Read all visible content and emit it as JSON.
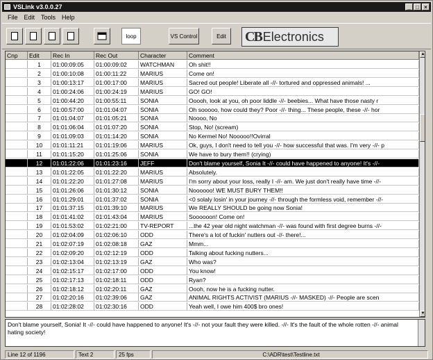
{
  "window": {
    "title": "VSLink v3.0.0.27",
    "controls": [
      "_",
      "□",
      "×"
    ]
  },
  "menu": [
    "File",
    "Edit",
    "Tools",
    "Help"
  ],
  "toolbar": {
    "loop_label": "loop",
    "vs_control_label": "VS Control",
    "edit_label": "Edit",
    "logo_mark": "CB",
    "logo_text": "Electronics"
  },
  "grid": {
    "columns": [
      "Cnp",
      "Edit",
      "Rec In",
      "Rec Out",
      "Character",
      "Comment"
    ],
    "selected_row": 12,
    "rows": [
      {
        "edit": "1",
        "in": "01:00:09:05",
        "out": "01:00:09:02",
        "char": "WATCHMAN",
        "comment": "Oh shit!!"
      },
      {
        "edit": "2",
        "in": "01:00:10:08",
        "out": "01:00:11:22",
        "char": "MARIUS",
        "comment": "Come on!"
      },
      {
        "edit": "3",
        "in": "01:00:13:17",
        "out": "01:00:17:00",
        "char": "MARIUS",
        "comment": "Sacred out people! Liberate all -//- tortured and oppressed animals! ..."
      },
      {
        "edit": "4",
        "in": "01:00:24:06",
        "out": "01:00:24:19",
        "char": "MARIUS",
        "comment": "GO! GO!"
      },
      {
        "edit": "5",
        "in": "01:00:44:20",
        "out": "01:00:55:11",
        "char": "SONIA",
        "comment": "Ooooh, look at you, oh poor liddle -//- beebies... What have those nasty r"
      },
      {
        "edit": "6",
        "in": "01:00:57:00",
        "out": "01:01:04:07",
        "char": "SONIA",
        "comment": "Oh sooooo, how could they? Poor -//- thing... These people, these -//- hor"
      },
      {
        "edit": "7",
        "in": "01:01:04:07",
        "out": "01:01:05:21",
        "char": "SONIA",
        "comment": "Noooo, No"
      },
      {
        "edit": "8",
        "in": "01:01:06:04",
        "out": "01:01:07:20",
        "char": "SONIA",
        "comment": "Stop, No! (scream)"
      },
      {
        "edit": "9",
        "in": "01:01:09:03",
        "out": "01:01:14:20",
        "char": "SONIA",
        "comment": "No Kermel No! Nooooo!!Ovirral"
      },
      {
        "edit": "10",
        "in": "01:01:11:21",
        "out": "01:01:19:06",
        "char": "MARIUS",
        "comment": "Ok, guys, I don't need to tell you -//- how successful that was. I'm very -//- p"
      },
      {
        "edit": "11",
        "in": "01:01:15:20",
        "out": "01:01:25:06",
        "char": "SONIA",
        "comment": "We have to bury them!! (crying)"
      },
      {
        "edit": "12",
        "in": "01:01:22:06",
        "out": "01:01:23:16",
        "char": "JEFF",
        "comment": "Don't blame yourself, Sonia It -//- could have happened to anyone! It's -//-"
      },
      {
        "edit": "13",
        "in": "01:01:22:05",
        "out": "01:01:22:20",
        "char": "MARIUS",
        "comment": "Absolutely."
      },
      {
        "edit": "14",
        "in": "01:01:22:20",
        "out": "01:01:27:08",
        "char": "MARIUS",
        "comment": "I'm sorry about your loss, really I -//- am. We just don't really have time -//-"
      },
      {
        "edit": "15",
        "in": "01:01:26:06",
        "out": "01:01:30:12",
        "char": "SONIA",
        "comment": "Noooooo! WE MUST BURY THEM!!"
      },
      {
        "edit": "16",
        "in": "01:01:29:01",
        "out": "01:01:37:02",
        "char": "SONIA",
        "comment": "<0 solaly losin' in your journey -//- through the formless void, remember -//-"
      },
      {
        "edit": "17",
        "in": "01:01:37:15",
        "out": "01:01:39:10",
        "char": "MARIUS",
        "comment": "We REALLY SHOULD be going now Sonia!"
      },
      {
        "edit": "18",
        "in": "01:01:41:02",
        "out": "01:01:43:04",
        "char": "MARIUS",
        "comment": "Soooooon! Come on!"
      },
      {
        "edit": "19",
        "in": "01:01:53:02",
        "out": "01:02:21:00",
        "char": "TV-REPORT",
        "comment": "...the 42 year old night watchman -//- was found with first degree burns -//-"
      },
      {
        "edit": "20",
        "in": "01:02:04:09",
        "out": "01:02:06:10",
        "char": "ODD",
        "comment": "There's a lot of fuckin' nutters out -//- there!..."
      },
      {
        "edit": "21",
        "in": "01:02:07:19",
        "out": "01:02:08:18",
        "char": "GAZ",
        "comment": "Mmm..."
      },
      {
        "edit": "22",
        "in": "01:02:09:20",
        "out": "01:02:12:19",
        "char": "ODD",
        "comment": "Talking about fucking nutters..."
      },
      {
        "edit": "23",
        "in": "01:02:13:04",
        "out": "01:02:13:19",
        "char": "GAZ",
        "comment": "Who was?"
      },
      {
        "edit": "24",
        "in": "01:02:15:17",
        "out": "01:02:17:00",
        "char": "ODD",
        "comment": "You know!"
      },
      {
        "edit": "25",
        "in": "01:02:17:13",
        "out": "01:02:18:11",
        "char": "ODD",
        "comment": "Ryan?"
      },
      {
        "edit": "26",
        "in": "01:02:18:12",
        "out": "01:02:20:11",
        "char": "GAZ",
        "comment": "Oooh, now he is a fucking nutter."
      },
      {
        "edit": "27",
        "in": "01:02:20:16",
        "out": "01:02:39:06",
        "char": "GAZ",
        "comment": "ANIMAL RIGHTS ACTIVIST (MARIUS -//- MASKED) -//- People are scen"
      },
      {
        "edit": "28",
        "in": "01:02:28:02",
        "out": "01:02:30:16",
        "char": "ODD",
        "comment": "Yeah well, I owe him 400$ bro ones!"
      }
    ]
  },
  "editor": {
    "text": "Don't blame yourself, Sonia! It -//- could have happened to anyone! It's -//- not your fault they were killed. -//- It's the fault of the whole rotten -//- animal hating society!"
  },
  "status": {
    "line": "Line 12 of 1196",
    "text": "Text 2",
    "fps": "25 fps",
    "path": "C:\\ADR\\test\\Testline.txt"
  }
}
